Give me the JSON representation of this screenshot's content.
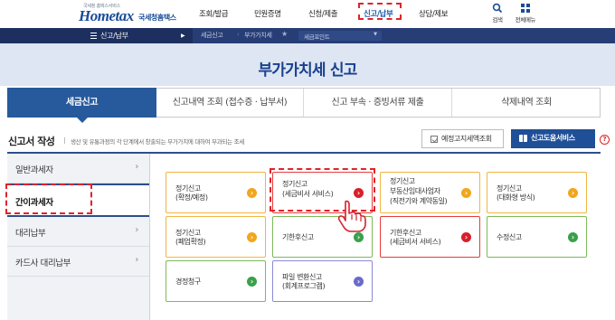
{
  "header": {
    "logo": {
      "sub": "국세청 홈택스서비스",
      "main": "Hometax",
      "kor": "국세청홈택스"
    },
    "gnb": [
      {
        "label": "조회/발급",
        "active": false
      },
      {
        "label": "민원증명",
        "active": false
      },
      {
        "label": "신청/제출",
        "active": false
      },
      {
        "label": "신고/납부",
        "active": true
      },
      {
        "label": "상담/제보",
        "active": false
      }
    ],
    "tools": {
      "search_label": "검색",
      "allmenu_label": "전체메뉴"
    }
  },
  "locbar": {
    "menu_title": "신고/납부",
    "crumbs": [
      "세금신고",
      "부가가치세"
    ],
    "point_dropdown": "세금포인트"
  },
  "page_title": "부가가치세 신고",
  "tabs": [
    {
      "label": "세금신고",
      "active": true
    },
    {
      "label": "신고내역 조회 (접수증 · 납부서)",
      "active": false
    },
    {
      "label": "신고 부속 · 증빙서류 제출",
      "active": false
    },
    {
      "label": "삭제내역 조회",
      "active": false
    }
  ],
  "section": {
    "title": "신고서 작성",
    "description": "생산 및 유통과정의 각 단계에서 창출되는 부가가치에 대하여 부과되는 조세",
    "notice_button": "예정고지세액조회",
    "help_button": "신고도움서비스",
    "help_icon": "?"
  },
  "side_menu": [
    {
      "label": "일반과세자",
      "active": false
    },
    {
      "label": "간이과세자",
      "active": true
    },
    {
      "label": "대리납부",
      "active": false
    },
    {
      "label": "카드사 대리납부",
      "active": false
    }
  ],
  "cards": [
    {
      "line1": "정기신고",
      "line2": "(확정/예정)",
      "color": "orange"
    },
    {
      "line1": "정기신고",
      "line2": "(세금비서 서비스)",
      "color": "red"
    },
    {
      "line1": "정기신고",
      "line2": "부동산임대사업자",
      "line3": "(직전기와 계약동일)",
      "color": "orange"
    },
    {
      "line1": "정기신고",
      "line2": "(대화형 방식)",
      "color": "orange"
    },
    {
      "line1": "정기신고",
      "line2": "(폐업확정)",
      "color": "orange"
    },
    {
      "line1": "기한후신고",
      "color": "green"
    },
    {
      "line1": "기한후신고",
      "line2": "(세금비서 서비스)",
      "color": "red"
    },
    {
      "line1": "수정신고",
      "color": "green"
    },
    {
      "line1": "경정청구",
      "color": "green"
    },
    {
      "line1": "파일 변환신고",
      "line2": "(회계프로그램)",
      "color": "purple"
    }
  ],
  "arrow_glyph": "›",
  "chevron_glyph": "›",
  "colors": {
    "brand_blue": "#1a4c98",
    "nav_dark": "#1c2f5f",
    "tab_active": "#275a9c",
    "highlight_red": "#e0232b",
    "arrow_orange": "#f2a61c",
    "arrow_green": "#3aa04a",
    "arrow_red": "#d81f2b",
    "arrow_purple": "#6a6ac9"
  }
}
